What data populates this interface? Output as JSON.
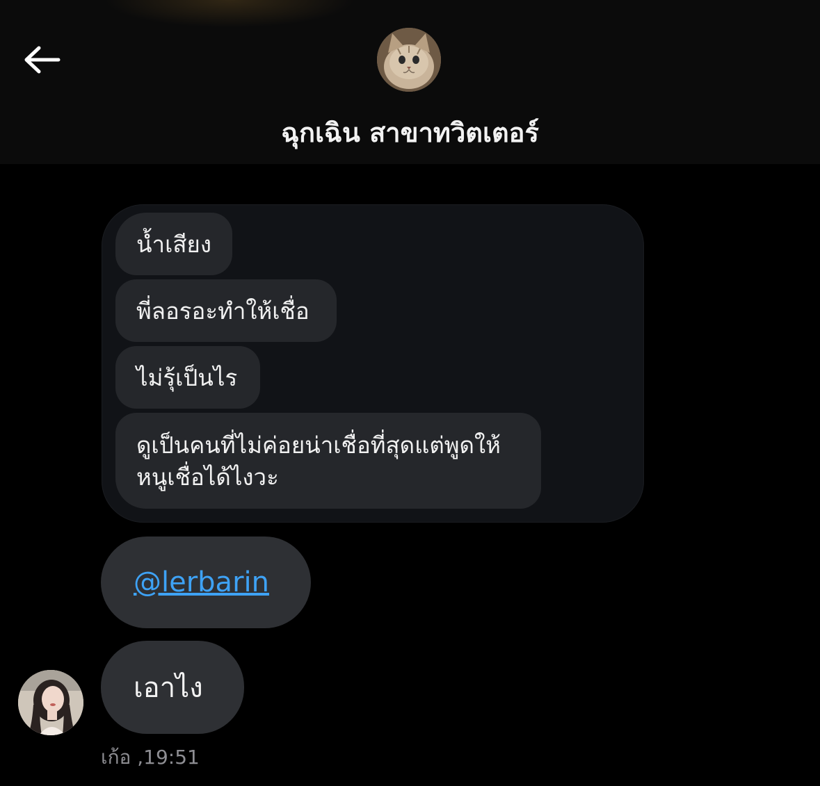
{
  "header": {
    "back_icon": "arrow-left-icon",
    "title": "ฉุกเฉิน สาขาทวิตเตอร์",
    "avatar": "cat-avatar"
  },
  "quoted_messages": [
    {
      "text": "น้ำเสียง"
    },
    {
      "text": "พี่ลอรอะทำให้เชื่อ"
    },
    {
      "text": "ไม่รุ้เป็นไร"
    },
    {
      "lines": [
        "ดูเป็นคนที่ไม่ค่อยน่าเชื่อที่สุดแต่พูดให้",
        "หนูเชื่อได้ไงวะ"
      ]
    }
  ],
  "messages": [
    {
      "text": "@lerbarin",
      "type": "mention"
    },
    {
      "text": "เอาไง",
      "type": "text"
    }
  ],
  "sender": {
    "avatar": "user-avatar",
    "meta": "เก้อ ,19:51"
  },
  "colors": {
    "background": "#000000",
    "bubble": "#2e3034",
    "quoted_bubble": "#25272b",
    "mention": "#3ea2f5",
    "timestamp": "#8e8e93"
  }
}
